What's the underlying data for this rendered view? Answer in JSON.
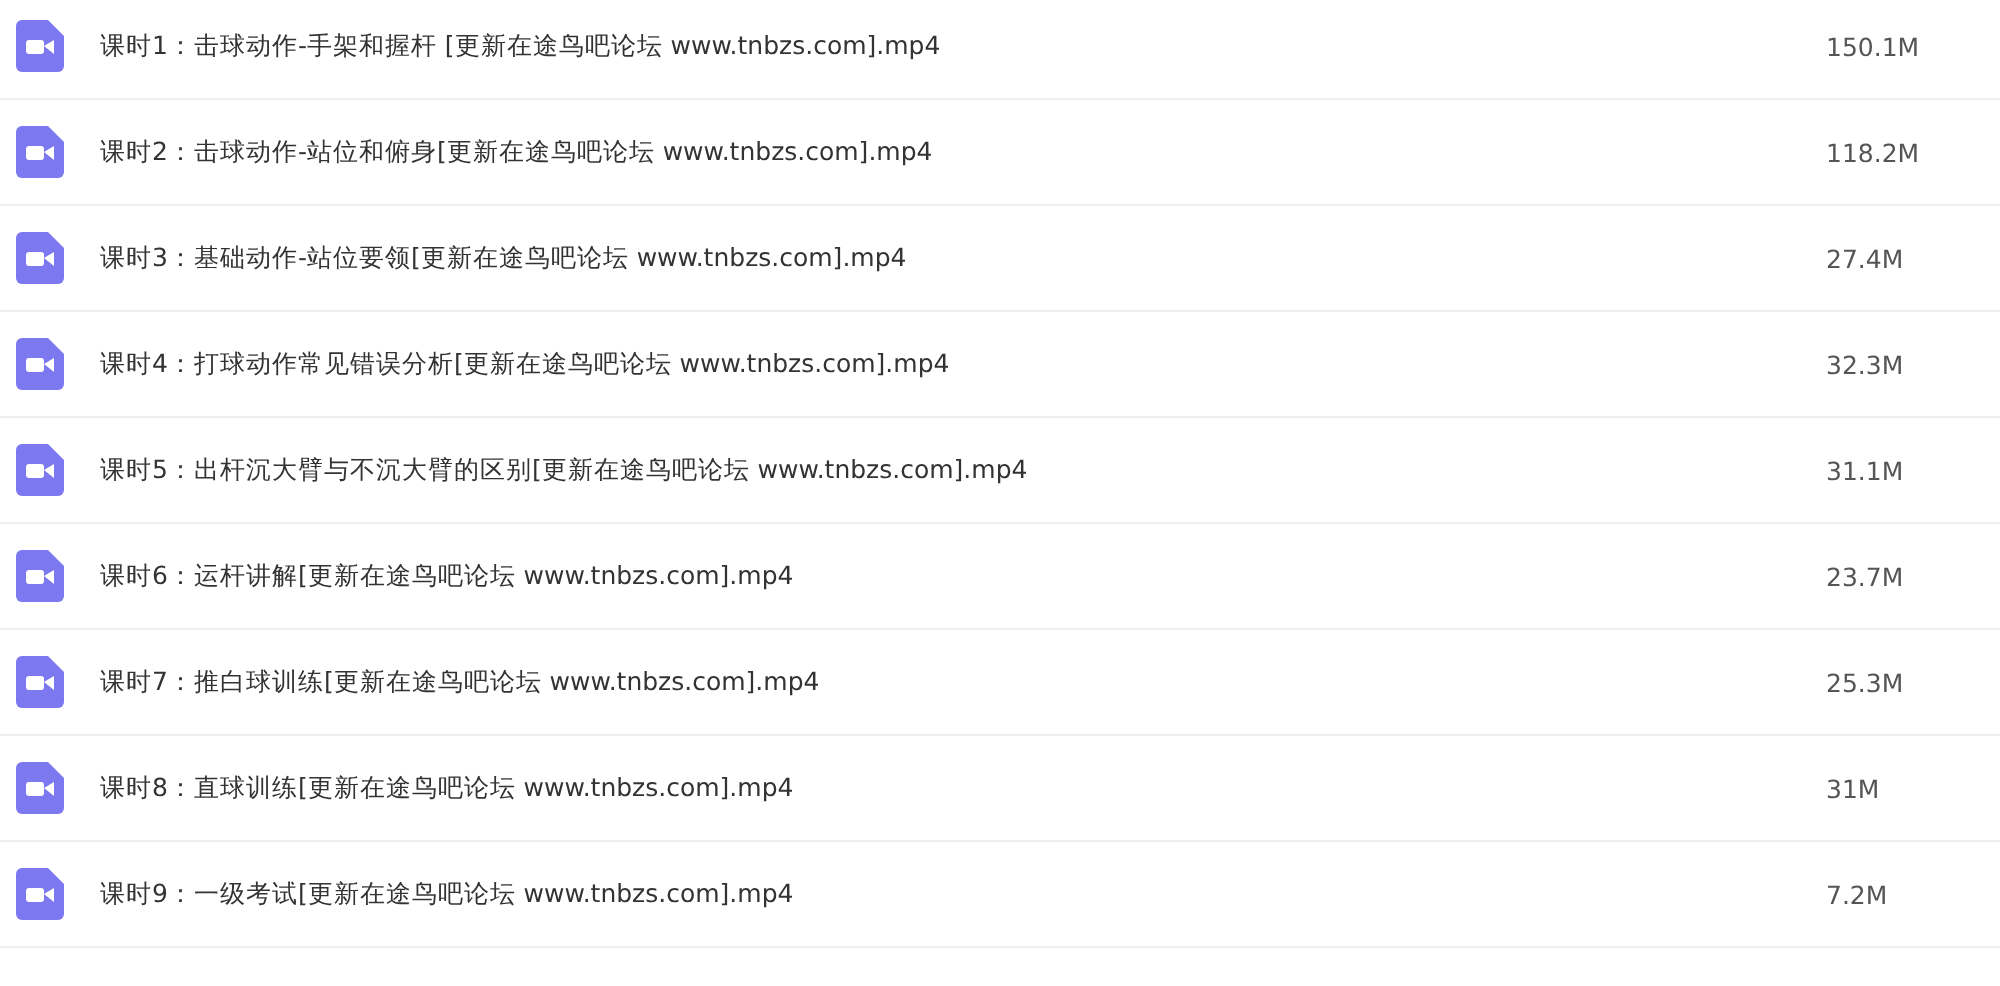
{
  "files": [
    {
      "name": "课时1：击球动作-手架和握杆 [更新在途鸟吧论坛 www.tnbzs.com].mp4",
      "size": "150.1M"
    },
    {
      "name": "课时2：击球动作-站位和俯身[更新在途鸟吧论坛 www.tnbzs.com].mp4",
      "size": "118.2M"
    },
    {
      "name": "课时3：基础动作-站位要领[更新在途鸟吧论坛 www.tnbzs.com].mp4",
      "size": "27.4M"
    },
    {
      "name": "课时4：打球动作常见错误分析[更新在途鸟吧论坛 www.tnbzs.com].mp4",
      "size": "32.3M"
    },
    {
      "name": "课时5：出杆沉大臂与不沉大臂的区别[更新在途鸟吧论坛 www.tnbzs.com].mp4",
      "size": "31.1M"
    },
    {
      "name": "课时6：运杆讲解[更新在途鸟吧论坛 www.tnbzs.com].mp4",
      "size": "23.7M"
    },
    {
      "name": "课时7：推白球训练[更新在途鸟吧论坛 www.tnbzs.com].mp4",
      "size": "25.3M"
    },
    {
      "name": "课时8：直球训练[更新在途鸟吧论坛 www.tnbzs.com].mp4",
      "size": "31M"
    },
    {
      "name": "课时9：一级考试[更新在途鸟吧论坛 www.tnbzs.com].mp4",
      "size": "7.2M"
    }
  ]
}
